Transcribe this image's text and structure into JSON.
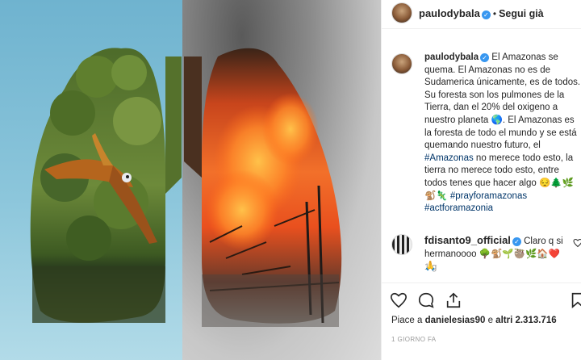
{
  "post": {
    "username": "paulodybala",
    "follow_label": "Segui già",
    "caption_parts": {
      "text1": " El Amazonas se quema. El Amazonas no es de Sudamerica únicamente, es de todos. Su foresta son los pulmones de la Tierra, dan el 20% del oxigeno a nuestro planeta ",
      "globe": "🌎",
      "text2": ". El Amazonas es la foresta de todo el mundo y se está quemando nuestro futuro, el ",
      "tag1": "#Amazonas",
      "text3": " no merece todo esto, la tierra no merece todo esto, entre todos tenes que hacer algo ",
      "emoji1": "😔🌲🌿",
      "emoji2": "🐒🦎",
      "tag2": "#prayforamazonas",
      "tag3": "#actforamazonia"
    },
    "time_ago": "1 g",
    "comment": {
      "username": "fdisanto9_official",
      "text": " Claro q si hermanoooo ",
      "emoji": "🌳🐒🌱🦥🌿🏠❤️",
      "emoji2": "🙏"
    },
    "likes_prefix": "Piace a ",
    "likes_user": "danielesias90",
    "likes_mid": " e ",
    "likes_count": "altri 2.313.716",
    "date": "1 GIORNO FA"
  },
  "icons": [
    "verified-badge-icon",
    "heart-icon",
    "comment-icon",
    "share-icon",
    "bookmark-icon"
  ],
  "colors": {
    "link": "#003569",
    "verified": "#3897f0",
    "muted": "#999999",
    "heart": "#ed4956"
  }
}
